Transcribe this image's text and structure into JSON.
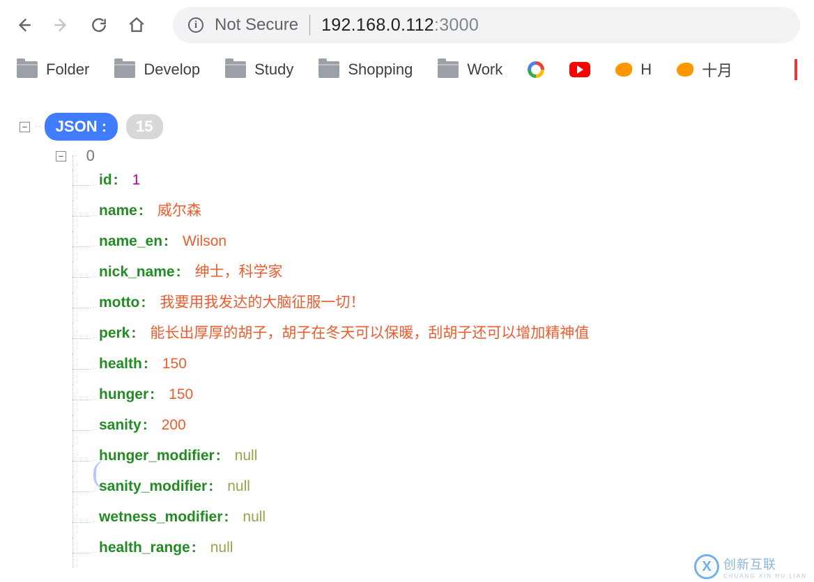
{
  "browser": {
    "security_label": "Not Secure",
    "url_host": "192.168.0.112",
    "url_port": ":3000"
  },
  "bookmarks": {
    "items": [
      "Folder",
      "Develop",
      "Study",
      "Shopping",
      "Work"
    ],
    "h_label": "H",
    "cjk_label": "十月"
  },
  "json_viewer": {
    "root_label": "JSON :",
    "count": "15",
    "index": "0",
    "entries": [
      {
        "key": "id",
        "value": "1",
        "type": "num"
      },
      {
        "key": "name",
        "value": "威尔森",
        "type": "str"
      },
      {
        "key": "name_en",
        "value": "Wilson",
        "type": "str"
      },
      {
        "key": "nick_name",
        "value": "绅士，科学家",
        "type": "str"
      },
      {
        "key": "motto",
        "value": "我要用我发达的大脑征服一切！",
        "type": "str"
      },
      {
        "key": "perk",
        "value": "能长出厚厚的胡子，胡子在冬天可以保暖，刮胡子还可以增加精神值",
        "type": "str"
      },
      {
        "key": "health",
        "value": "150",
        "type": "str"
      },
      {
        "key": "hunger",
        "value": "150",
        "type": "str"
      },
      {
        "key": "sanity",
        "value": "200",
        "type": "str"
      },
      {
        "key": "hunger_modifier",
        "value": "null",
        "type": "null"
      },
      {
        "key": "sanity_modifier",
        "value": "null",
        "type": "null"
      },
      {
        "key": "wetness_modifier",
        "value": "null",
        "type": "null"
      },
      {
        "key": "health_range",
        "value": "null",
        "type": "null"
      }
    ]
  },
  "watermark": {
    "brand": "创新互联",
    "sub": "CHUANG XIN HU LIAN",
    "mark": "X"
  }
}
